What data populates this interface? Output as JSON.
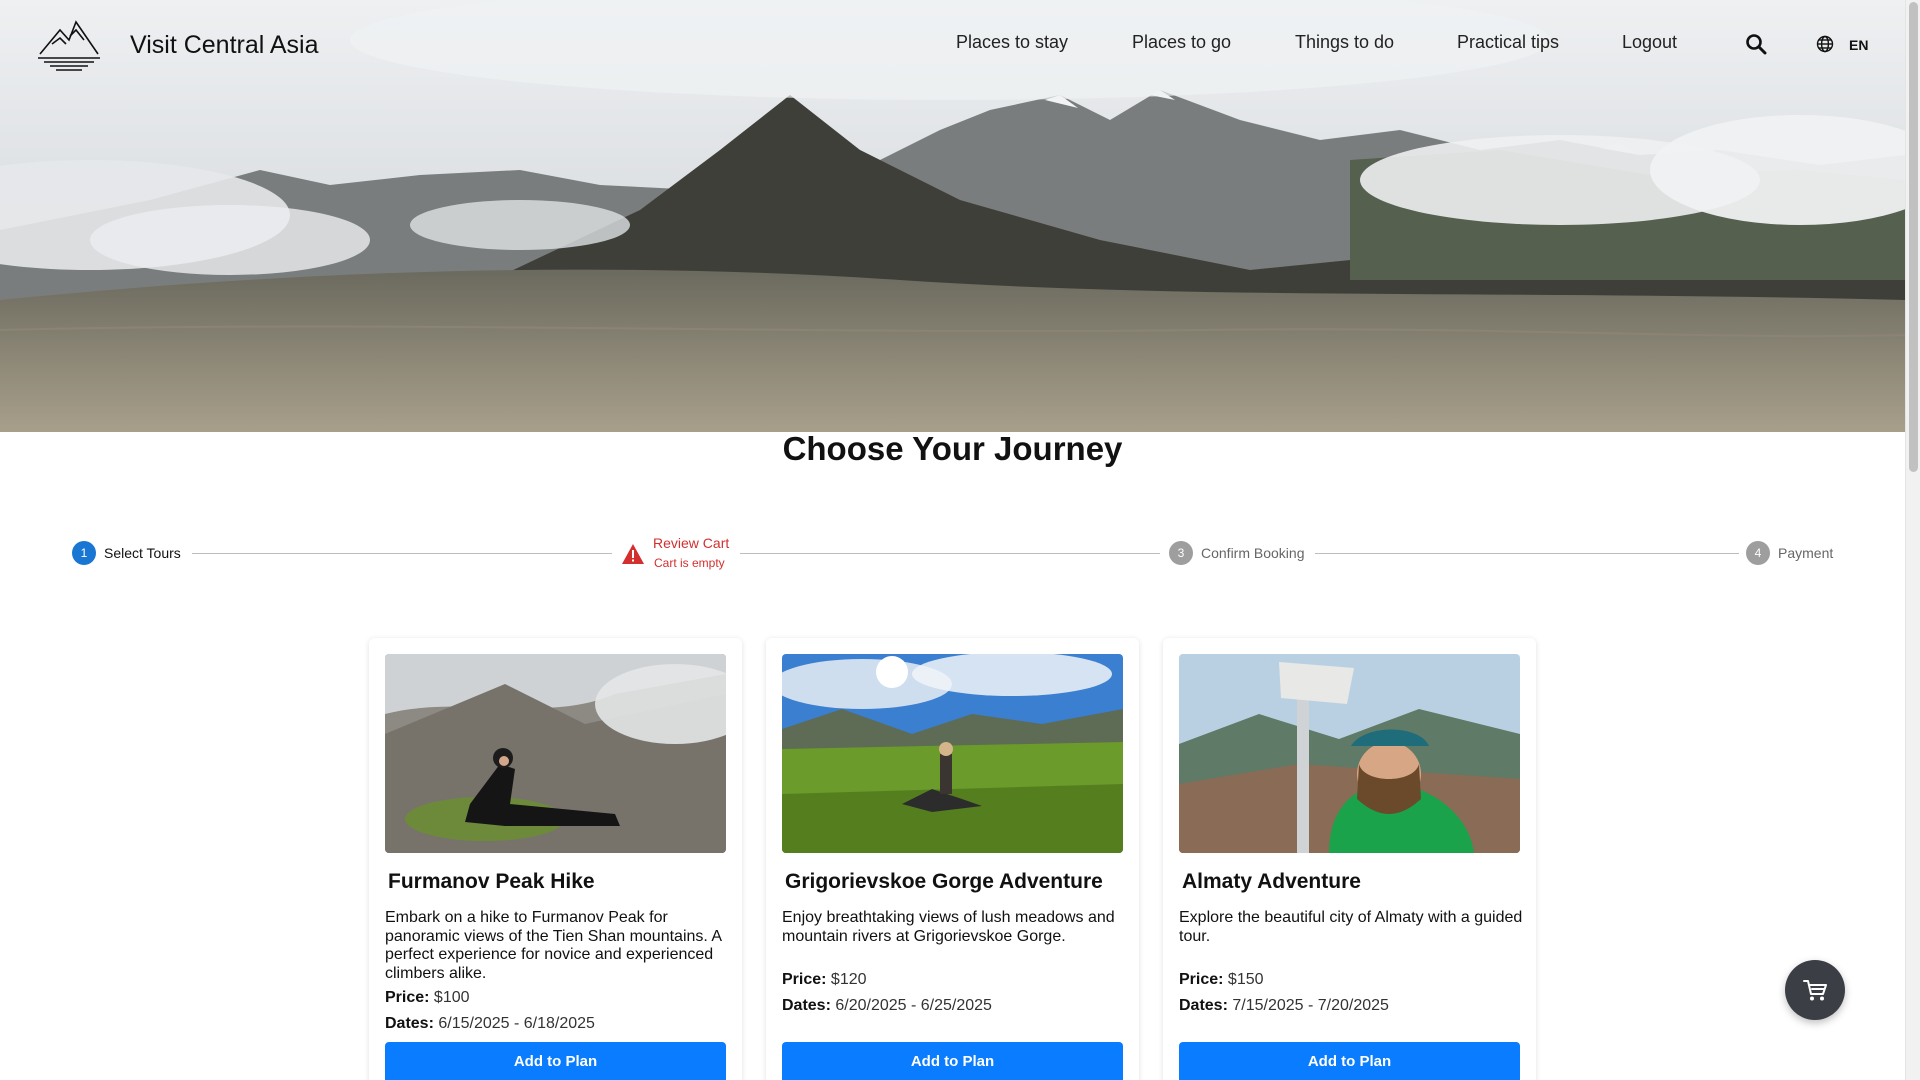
{
  "brand": {
    "name": "Visit Central Asia",
    "logo_icon": "mountain-logo-icon"
  },
  "nav": {
    "items": [
      "Places to stay",
      "Places to go",
      "Things to do",
      "Practical tips",
      "Logout"
    ],
    "search_icon": "search-icon",
    "language_icon": "globe-icon",
    "language": "EN"
  },
  "page": {
    "title": "Choose Your Journey"
  },
  "stepper": {
    "steps": [
      {
        "number": "1",
        "label": "Select Tours",
        "state": "active"
      },
      {
        "number": "",
        "label": "Review Cart",
        "sublabel": "Cart is empty",
        "state": "error"
      },
      {
        "number": "3",
        "label": "Confirm Booking",
        "state": "inactive"
      },
      {
        "number": "4",
        "label": "Payment",
        "state": "inactive"
      }
    ],
    "colors": {
      "active": "#1976d2",
      "error": "#d32f2f",
      "inactive": "#9e9e9e"
    }
  },
  "tours": [
    {
      "title": "Furmanov Peak Hike",
      "description": "Embark on a hike to Furmanov Peak for panoramic views of the Tien Shan mountains. A perfect experience for novice and experienced climbers alike.",
      "price_label": "Price:",
      "price": "$100",
      "dates_label": "Dates:",
      "dates": "6/15/2025 - 6/18/2025",
      "button": "Add to Plan"
    },
    {
      "title": "Grigorievskoe Gorge Adventure",
      "description": "Enjoy breathtaking views of lush meadows and mountain rivers at Grigorievskoe Gorge.",
      "price_label": "Price:",
      "price": "$120",
      "dates_label": "Dates:",
      "dates": "6/20/2025 - 6/25/2025",
      "button": "Add to Plan"
    },
    {
      "title": "Almaty Adventure",
      "description": "Explore the beautiful city of Almaty with a guided tour.",
      "price_label": "Price:",
      "price": "$150",
      "dates_label": "Dates:",
      "dates": "7/15/2025 - 7/20/2025",
      "button": "Add to Plan"
    }
  ],
  "cart_fab": {
    "icon": "cart-icon"
  },
  "colors": {
    "primary_button": "#0a7cff",
    "fab": "#3b3f45"
  }
}
